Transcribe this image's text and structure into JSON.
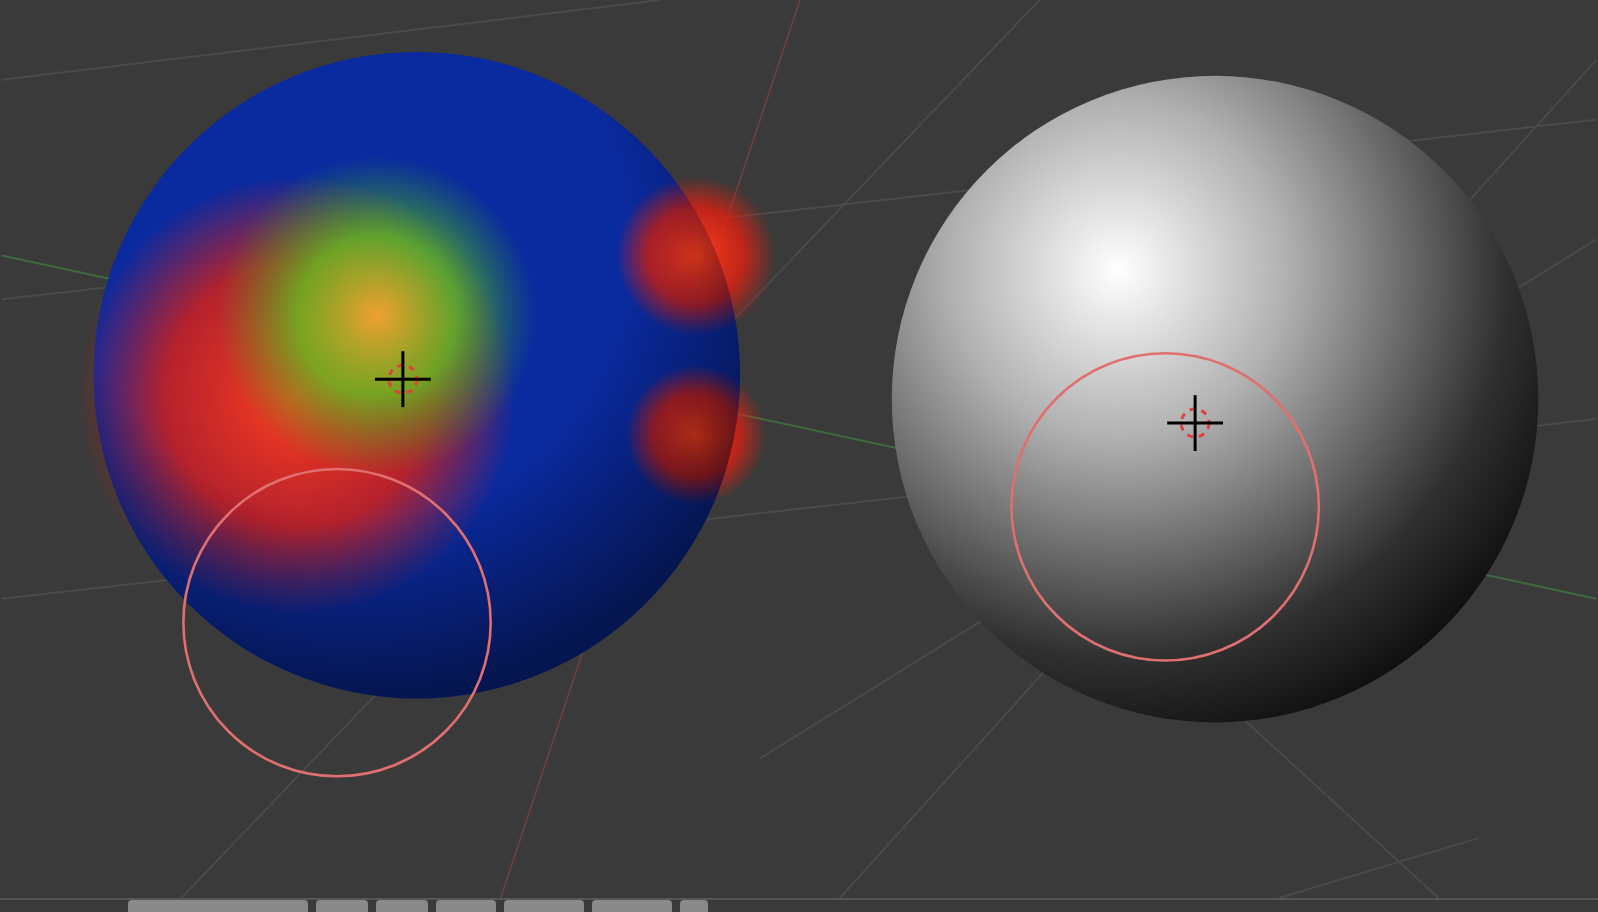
{
  "viewport": {
    "objects": [
      {
        "kind": "color"
      },
      {
        "kind": "gray"
      }
    ]
  }
}
